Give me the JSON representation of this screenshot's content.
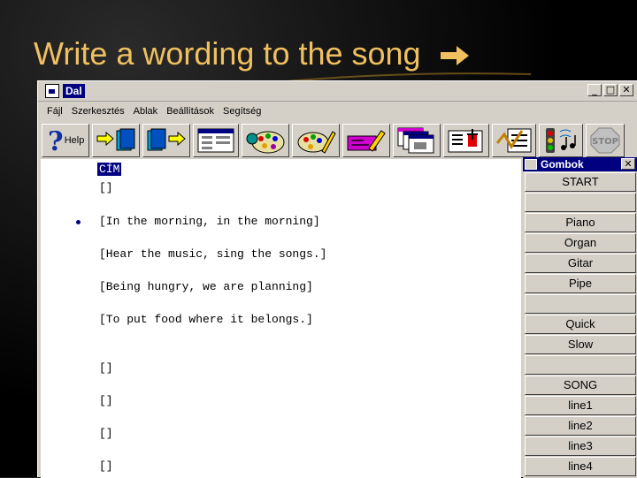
{
  "slide": {
    "title": "Write a wording to the song"
  },
  "window": {
    "title": "Dal",
    "controls": {
      "minimize": "_",
      "maximize": "□",
      "close": "✕"
    }
  },
  "menu": [
    "Fájl",
    "Szerkesztés",
    "Ablak",
    "Beállítások",
    "Segítség"
  ],
  "toolbar": {
    "help_label": "Help"
  },
  "editor": {
    "lines": [
      "CÍM",
      "[]",
      "[In the morning, in the morning]",
      "[Hear the music, sing the songs.]",
      "[Being hungry, we are planning]",
      "[To put food where it belongs.]",
      "[]",
      "[]",
      "[]",
      "[]"
    ]
  },
  "palette": {
    "title": "Gombok",
    "close": "✕",
    "buttons": [
      "START",
      "",
      "Piano",
      "Organ",
      "Gitar",
      "Pipe",
      "",
      "Quick",
      "Slow",
      "",
      "SONG",
      "line1",
      "line2",
      "line3",
      "line4"
    ]
  },
  "colors": {
    "title_text": "#f0c060",
    "selection": "#000080",
    "window_bg": "#d4d0c8"
  }
}
